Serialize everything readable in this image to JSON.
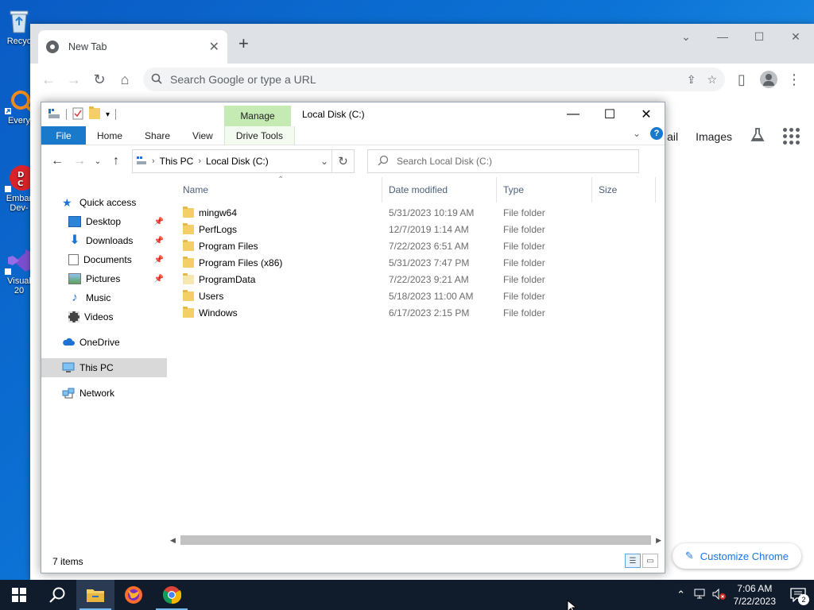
{
  "desktop": {
    "icons": [
      {
        "label": "Recyc",
        "icon": "recycle-bin-icon"
      },
      {
        "label": "Every",
        "icon": "everything-app-icon"
      },
      {
        "label": "Embar",
        "label2": "Dev-",
        "icon": "embarcadero-devcpp-icon"
      },
      {
        "label": "Visual",
        "label2": "20",
        "icon": "visual-studio-icon"
      }
    ]
  },
  "chrome": {
    "tab_title": "New Tab",
    "omnibox_placeholder": "Search Google or type a URL",
    "links": {
      "gmail": "ail",
      "images": "Images"
    },
    "customize_label": "Customize Chrome"
  },
  "explorer": {
    "manage_tab": "Manage",
    "title": "Local Disk (C:)",
    "ribbon_tabs": [
      "File",
      "Home",
      "Share",
      "View",
      "Drive Tools"
    ],
    "breadcrumb": [
      "This PC",
      "Local Disk (C:)"
    ],
    "search_placeholder": "Search Local Disk (C:)",
    "nav": {
      "quick_access": "Quick access",
      "pinned": [
        "Desktop",
        "Downloads",
        "Documents",
        "Pictures"
      ],
      "music": "Music",
      "videos": "Videos",
      "onedrive": "OneDrive",
      "this_pc": "This PC",
      "network": "Network"
    },
    "columns": [
      "Name",
      "Date modified",
      "Type",
      "Size"
    ],
    "files": [
      {
        "name": "mingw64",
        "date": "5/31/2023 10:19 AM",
        "type": "File folder"
      },
      {
        "name": "PerfLogs",
        "date": "12/7/2019 1:14 AM",
        "type": "File folder"
      },
      {
        "name": "Program Files",
        "date": "7/22/2023 6:51 AM",
        "type": "File folder"
      },
      {
        "name": "Program Files (x86)",
        "date": "5/31/2023 7:47 PM",
        "type": "File folder"
      },
      {
        "name": "ProgramData",
        "date": "7/22/2023 9:21 AM",
        "type": "File folder"
      },
      {
        "name": "Users",
        "date": "5/18/2023 11:00 AM",
        "type": "File folder"
      },
      {
        "name": "Windows",
        "date": "6/17/2023 2:15 PM",
        "type": "File folder"
      }
    ],
    "status": "7 items"
  },
  "taskbar": {
    "time": "7:06 AM",
    "date": "7/22/2023",
    "notification_count": "2"
  }
}
